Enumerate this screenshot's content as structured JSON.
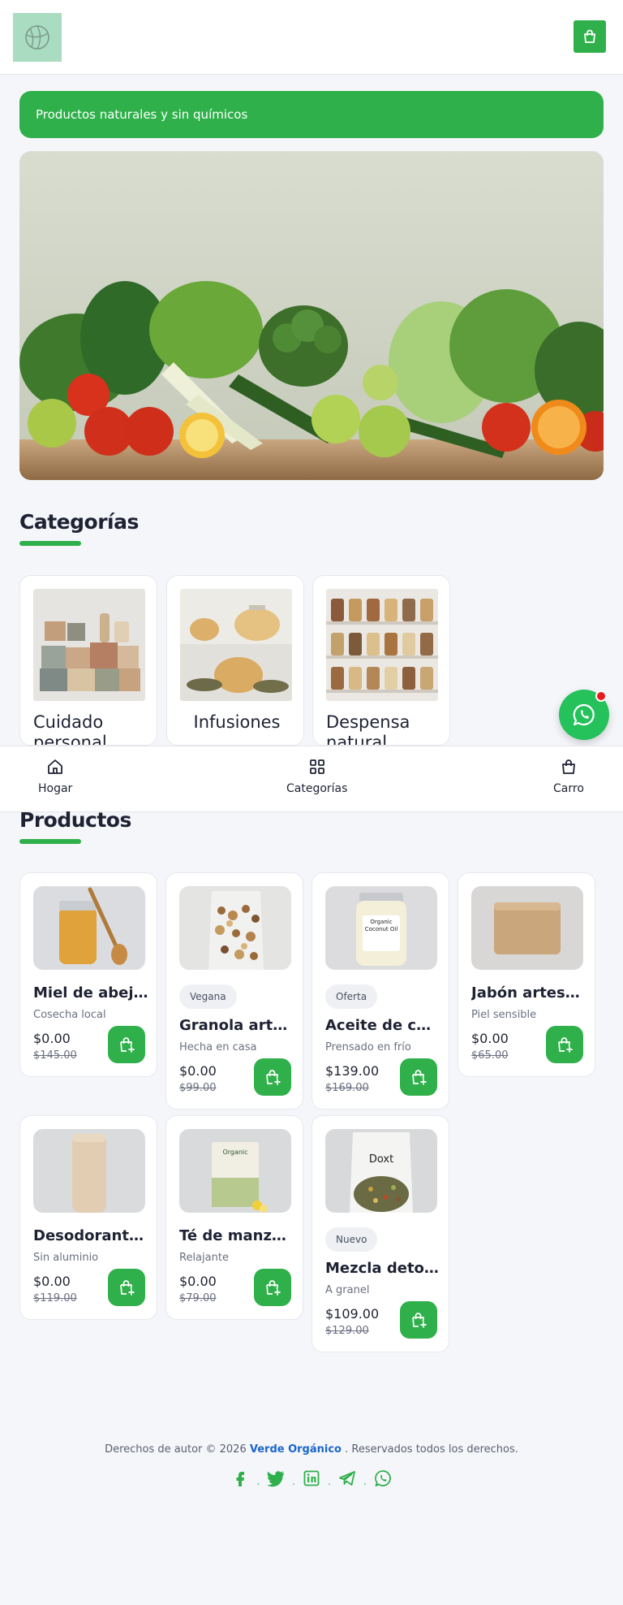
{
  "banner": {
    "text": "Productos naturales y sin químicos"
  },
  "categories_section": {
    "title": "Categorías"
  },
  "categories": [
    {
      "label": "Cuidado personal"
    },
    {
      "label": "Infusiones"
    },
    {
      "label": "Despensa natural"
    }
  ],
  "bottom_nav": {
    "home": "Hogar",
    "categories": "Categorías",
    "cart": "Carro"
  },
  "products_section": {
    "title": "Productos"
  },
  "products": [
    {
      "name": "Miel de abeja ...",
      "subtitle": "Cosecha local",
      "price": "$0.00",
      "old_price": "$145.00",
      "badge": ""
    },
    {
      "name": "Granola artes...",
      "subtitle": "Hecha en casa",
      "price": "$0.00",
      "old_price": "$99.00",
      "badge": "Vegana"
    },
    {
      "name": "Aceite de coc...",
      "subtitle": "Prensado en frío",
      "price": "$139.00",
      "old_price": "$169.00",
      "badge": "Oferta"
    },
    {
      "name": "Jabón artesa...",
      "subtitle": "Piel sensible",
      "price": "$0.00",
      "old_price": "$65.00",
      "badge": ""
    },
    {
      "name": "Desodorante ...",
      "subtitle": "Sin aluminio",
      "price": "$0.00",
      "old_price": "$119.00",
      "badge": ""
    },
    {
      "name": "Té de manzani...",
      "subtitle": "Relajante",
      "price": "$0.00",
      "old_price": "$79.00",
      "badge": ""
    },
    {
      "name": "Mezcla detox ...",
      "subtitle": "A granel",
      "price": "$109.00",
      "old_price": "$129.00",
      "badge": "Nuevo"
    }
  ],
  "product_image_text": {
    "coconut_oil_label": "Organic Coconut Oil",
    "tea_box_label": "Organic",
    "detox_bag_label": "Doxt"
  },
  "footer": {
    "prefix": "Derechos de autor © 2026 ",
    "brand": "Verde Orgánico",
    "suffix": " . Reservados todos los derechos."
  },
  "social_icons": [
    "facebook-icon",
    "twitter-icon",
    "linkedin-icon",
    "telegram-icon",
    "whatsapp-icon"
  ],
  "colors": {
    "accent": "#2fb04a",
    "whatsapp": "#25c15a",
    "notification": "#ea1b1b",
    "link": "#1b66c9",
    "background": "#f5f6fa"
  }
}
